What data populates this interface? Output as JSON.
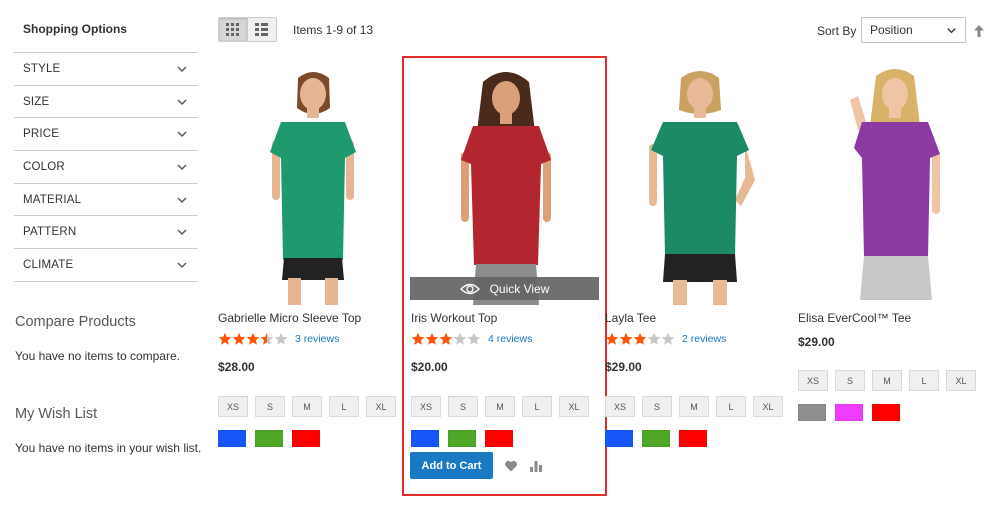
{
  "sidebar": {
    "title": "Shopping Options",
    "filters": [
      "STYLE",
      "SIZE",
      "PRICE",
      "COLOR",
      "MATERIAL",
      "PATTERN",
      "CLIMATE"
    ],
    "compare": {
      "title": "Compare Products",
      "text": "You have no items to compare."
    },
    "wishlist": {
      "title": "My Wish List",
      "text": "You have no items in your wish list."
    }
  },
  "toolbar": {
    "mode_grid": "grid-icon",
    "mode_list": "list-icon",
    "amount": "Items 1-9 of 13",
    "sort_label": "Sort By",
    "sort_value": "Position"
  },
  "quick_view": "Quick View",
  "add_to_cart": "Add to Cart",
  "products": [
    {
      "name": "Gabrielle Micro Sleeve Top",
      "rating": 3.5,
      "reviews": "3 reviews",
      "price": "$28.00",
      "sizes": [
        "XS",
        "S",
        "M",
        "L",
        "XL"
      ],
      "swatches": [
        "#1857f7",
        "#4fa627",
        "#ff0000"
      ],
      "shirt_color": "#1f9a6e"
    },
    {
      "name": "Iris Workout Top",
      "rating": 3,
      "reviews": "4 reviews",
      "price": "$20.00",
      "sizes": [
        "XS",
        "S",
        "M",
        "L",
        "XL"
      ],
      "swatches": [
        "#1857f7",
        "#4fa627",
        "#ff0000"
      ],
      "shirt_color": "#b3262f"
    },
    {
      "name": "Layla Tee",
      "rating": 3,
      "reviews": "2 reviews",
      "price": "$29.00",
      "sizes": [
        "XS",
        "S",
        "M",
        "L",
        "XL"
      ],
      "swatches": [
        "#1857f7",
        "#4fa627",
        "#ff0000"
      ],
      "shirt_color": "#1d8a67"
    },
    {
      "name": "Elisa EverCool™ Tee",
      "price": "$29.00",
      "sizes": [
        "XS",
        "S",
        "M",
        "L",
        "XL"
      ],
      "swatches": [
        "#8f8f8f",
        "#ef3dff",
        "#ff0000"
      ],
      "shirt_color": "#8a3aa1"
    }
  ]
}
